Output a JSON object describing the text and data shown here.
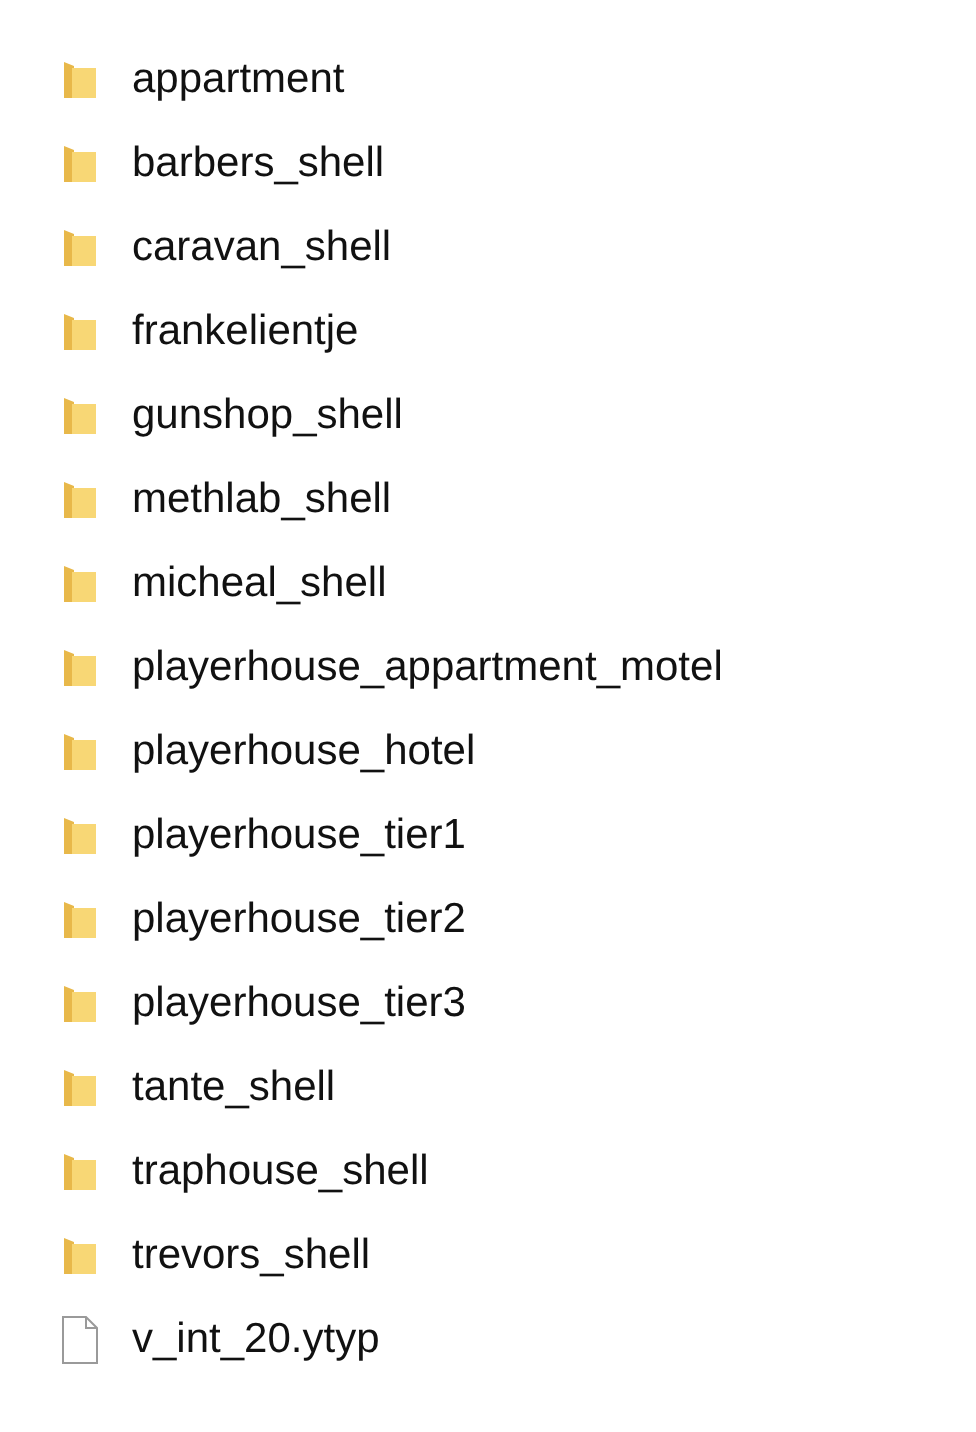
{
  "items": [
    {
      "kind": "folder",
      "name": "appartment"
    },
    {
      "kind": "folder",
      "name": "barbers_shell"
    },
    {
      "kind": "folder",
      "name": "caravan_shell"
    },
    {
      "kind": "folder",
      "name": "frankelientje"
    },
    {
      "kind": "folder",
      "name": "gunshop_shell"
    },
    {
      "kind": "folder",
      "name": "methlab_shell"
    },
    {
      "kind": "folder",
      "name": "micheal_shell"
    },
    {
      "kind": "folder",
      "name": "playerhouse_appartment_motel"
    },
    {
      "kind": "folder",
      "name": "playerhouse_hotel"
    },
    {
      "kind": "folder",
      "name": "playerhouse_tier1"
    },
    {
      "kind": "folder",
      "name": "playerhouse_tier2"
    },
    {
      "kind": "folder",
      "name": "playerhouse_tier3"
    },
    {
      "kind": "folder",
      "name": "tante_shell"
    },
    {
      "kind": "folder",
      "name": "traphouse_shell"
    },
    {
      "kind": "folder",
      "name": "trevors_shell"
    },
    {
      "kind": "file",
      "name": "v_int_20.ytyp"
    }
  ]
}
